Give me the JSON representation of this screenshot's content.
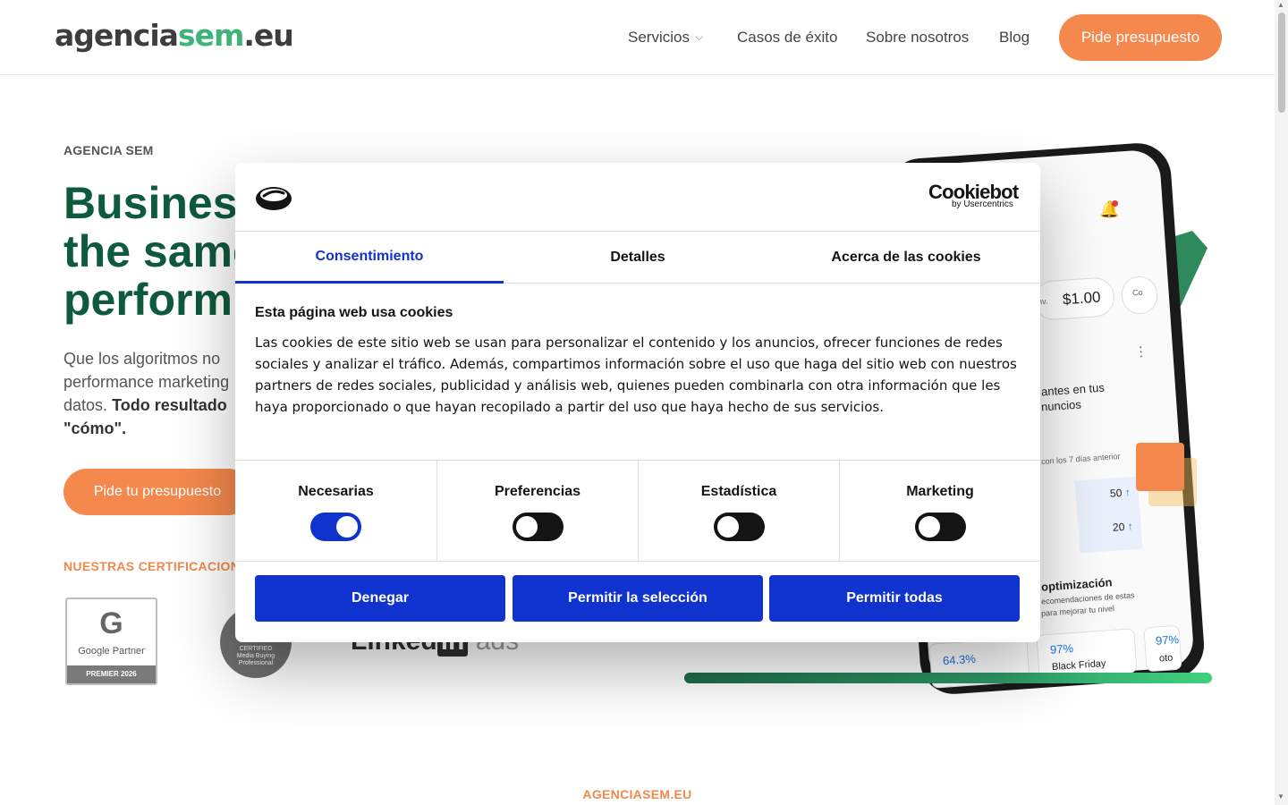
{
  "header": {
    "logo_part1": "agencia",
    "logo_part2": "sem",
    "logo_part3": ".eu",
    "nav": {
      "servicios": "Servicios",
      "casos": "Casos de éxito",
      "sobre": "Sobre nosotros",
      "blog": "Blog"
    },
    "cta": "Pide presupuesto"
  },
  "hero": {
    "eyebrow": "AGENCIA SEM",
    "title_line1": "Business",
    "title_line2": "the same",
    "title_line3": "perform",
    "sub_line1": "Que los algoritmos no",
    "sub_line2": "performance marketing",
    "sub_line3_a": "datos.",
    "sub_line3_b": "Todo resultado",
    "sub_line4": "\"cómo\".",
    "cta": "Pide tu presupuesto",
    "certs_title": "NUESTRAS CERTIFICACIONE",
    "google_badge": {
      "glyph": "G",
      "label": "Google Partner",
      "bar": "PREMIER 2026"
    },
    "meta_badge": {
      "line1": "CERTIFIED",
      "line2": "Media Buying",
      "line3": "Professional"
    },
    "linkedin_badge": {
      "word": "Linked",
      "in": "in",
      "ads": "ads"
    }
  },
  "phone": {
    "price": "$1.00",
    "price_label": "nv.",
    "chip2_label": "Co",
    "headline1": "antes en tus",
    "headline2": "nuncios",
    "compare": "con los 7 días anterior",
    "value1": "50",
    "value2": "20",
    "arrow": "↑",
    "opt_title": "optimización",
    "opt_line1": "ecomendaciones de estas",
    "opt_line2": "para mejorar tu nivel",
    "pct1": "64.3%",
    "pct2": "97%",
    "pct3": "97%",
    "bf_label": "Black Friday",
    "oto_label": "oto"
  },
  "cookie": {
    "brand": "Cookiebot",
    "brand_sub": "by Usercentrics",
    "tabs": [
      "Consentimiento",
      "Detalles",
      "Acerca de las cookies"
    ],
    "active_tab": "Consentimiento",
    "title": "Esta página web usa cookies",
    "body": "Las cookies de este sitio web se usan para personalizar el contenido y los anuncios, ofrecer funciones de redes sociales y analizar el tráfico. Además, compartimos información sobre el uso que haga del sitio web con nuestros partners de redes sociales, publicidad y análisis web, quienes pueden combinarla con otra información que les haya proporcionado o que hayan recopilado a partir del uso que haya hecho de sus servicios.",
    "toggles": [
      {
        "label": "Necesarias",
        "on": true
      },
      {
        "label": "Preferencias",
        "on": false
      },
      {
        "label": "Estadística",
        "on": false
      },
      {
        "label": "Marketing",
        "on": false
      }
    ],
    "buttons": {
      "deny": "Denegar",
      "selection": "Permitir la selección",
      "all": "Permitir todas"
    },
    "accent_color": "#1032cf"
  },
  "footer_kicker": "AGENCIASEM.EU",
  "colors": {
    "brand_orange": "#f5894d",
    "brand_green": "#0e5a3c",
    "logo_green": "#3fb47a"
  },
  "icons": {
    "servicios_chevron": "chevron-down-icon",
    "bell": "bell-icon",
    "cookiebot_logo": "cookiebot-logo-icon"
  }
}
